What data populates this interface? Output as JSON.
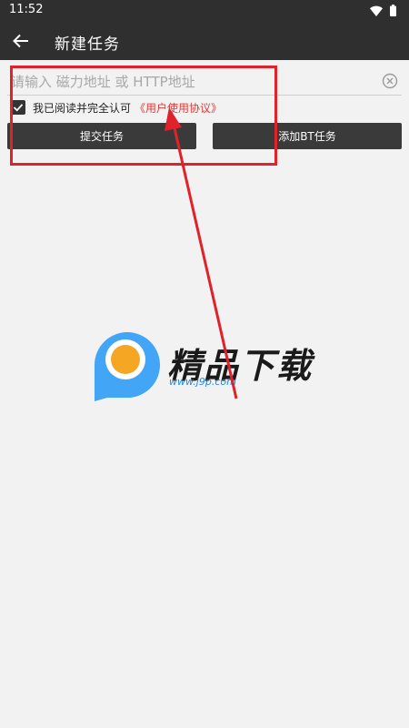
{
  "status_bar": {
    "time": "11:52",
    "icons": [
      "wifi-icon",
      "battery-icon"
    ]
  },
  "app_bar": {
    "back_icon": "arrow-left-icon",
    "title": "新建任务"
  },
  "form": {
    "url_placeholder": "请输入 磁力地址 或 HTTP地址",
    "url_value": "",
    "clear_icon": "clear-circle-icon",
    "agree_checked": true,
    "agree_text": "我已阅读并完全认可",
    "agreement_link": "《用户使用协议》",
    "submit_label": "提交任务",
    "add_bt_label": "添加BT任务"
  },
  "annotation": {
    "highlight_color": "#e0222a"
  },
  "watermark": {
    "brand": "精品下载",
    "url": "www.j9p.com"
  },
  "colors": {
    "app_bar": "#2f2f2f",
    "background": "#f2f2f2",
    "button": "#3a3a3a",
    "link": "#e53935",
    "logo_blue": "#42a5f5",
    "logo_orange": "#f5a623"
  }
}
